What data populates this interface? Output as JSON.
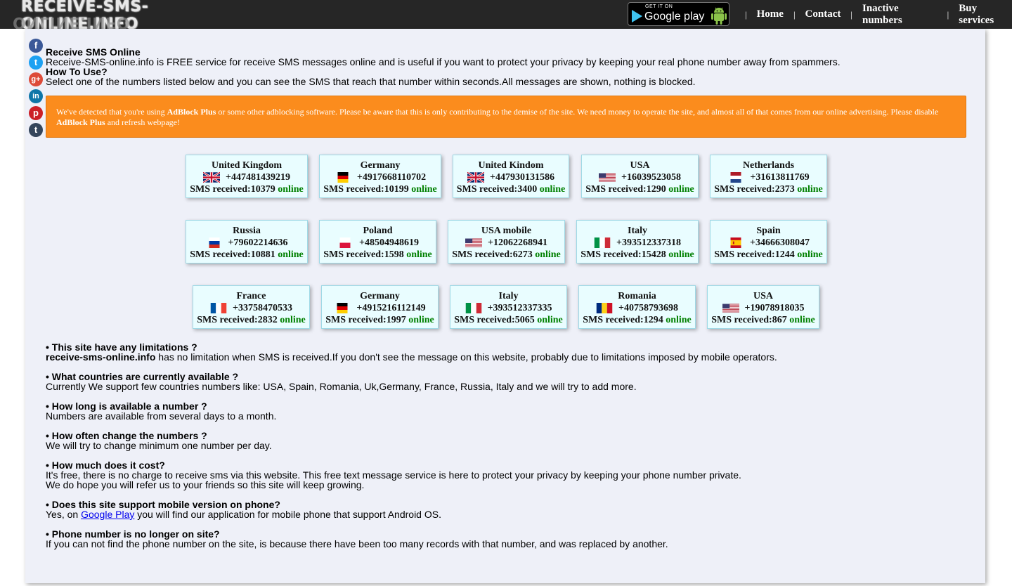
{
  "header": {
    "logo_text": "RECEIVE-SMS-ONLINE.INFO",
    "gplay_small": "GET IT ON",
    "gplay_big": "Google play",
    "nav": [
      "Home",
      "Contact",
      "Inactive numbers",
      "Buy services"
    ],
    "separator": "|"
  },
  "social": [
    "f",
    "t",
    "g+",
    "in",
    "p",
    "t"
  ],
  "intro": {
    "title": "Receive SMS Online",
    "desc": "Receive-SMS-online.info is FREE service for receive SMS messages online and is useful if you want to protect your privacy by keeping your real phone number away from spammers.",
    "howto_title": "How To Use?",
    "howto_desc": "Select one of the numbers listed below and you can see the SMS that reach that number within seconds.All messages are shown, nothing is blocked."
  },
  "adblock": {
    "p1": "We've detected that you're using ",
    "b1": "AdBlock Plus",
    "p2": " or some other adblocking software. Please be aware that this is only contributing to the demise of the site. We need money to operate the site, and almost all of that comes from our online advertising. Please disable ",
    "b2": "AdBlock Plus",
    "p3": " and refresh webpage!"
  },
  "sms_label": "SMS received:",
  "online_label": "online",
  "numbers": [
    {
      "country": "United Kingdom",
      "phone": "+447481439219",
      "sms": "10379",
      "flag": "uk"
    },
    {
      "country": "Germany",
      "phone": "+4917668110702",
      "sms": "10199",
      "flag": "de"
    },
    {
      "country": "United Kindom",
      "phone": "+447930131586",
      "sms": "3400",
      "flag": "uk"
    },
    {
      "country": "USA",
      "phone": "+16039523058",
      "sms": "1290",
      "flag": "us"
    },
    {
      "country": "Netherlands",
      "phone": "+31613811769",
      "sms": "2373",
      "flag": "nl"
    },
    {
      "country": "Russia",
      "phone": "+79602214636",
      "sms": "10881",
      "flag": "ru"
    },
    {
      "country": "Poland",
      "phone": "+48504948619",
      "sms": "1598",
      "flag": "pl"
    },
    {
      "country": "USA mobile",
      "phone": "+12062268941",
      "sms": "6273",
      "flag": "us"
    },
    {
      "country": "Italy",
      "phone": "+393512337318",
      "sms": "15428",
      "flag": "it"
    },
    {
      "country": "Spain",
      "phone": "+34666308047",
      "sms": "1244",
      "flag": "es"
    },
    {
      "country": "France",
      "phone": "+33758470533",
      "sms": "2832",
      "flag": "fr"
    },
    {
      "country": "Germany",
      "phone": "+4915216112149",
      "sms": "1997",
      "flag": "de"
    },
    {
      "country": "Italy",
      "phone": "+393512337335",
      "sms": "5065",
      "flag": "it"
    },
    {
      "country": "Romania",
      "phone": "+40758793698",
      "sms": "1294",
      "flag": "ro"
    },
    {
      "country": "USA",
      "phone": "+19078918035",
      "sms": "867",
      "flag": "us"
    }
  ],
  "faq": {
    "q1": "• This site have any limitations ?",
    "a1_bold": "receive-sms-online.info",
    "a1": " has no limitation when SMS is received.If you don't see the message on this website, probably due to limitations imposed by mobile operators.",
    "q2": "• What countries are currently available ?",
    "a2": "Currently We support few countries numbers like: USA, Spain, Romania, Uk,Germany, France, Russia, Italy and we will try to add more.",
    "q3": "• How long is available a number ?",
    "a3": "Numbers are available from several days to a month.",
    "q4": "• How often change the numbers ?",
    "a4": "We will try to change minimum one number per day.",
    "q5": "• How much does it cost?",
    "a5a": "It's free, there is no charge to receive sms via this website. This free text message service is here to protect your privacy by keeping your phone number private.",
    "a5b": "We do hope you will refer us to your friends so this site will keep growing.",
    "q6": "• Does this site support mobile version on phone?",
    "a6_pre": "Yes, on ",
    "a6_link": "Google Play",
    "a6_post": " you will find our application for mobile phone that support Android OS.",
    "q7": "• Phone number is no longer on site?",
    "a7": "If you can not find the phone number on the site, is because there have been too many records with that number, and was replaced by another."
  }
}
